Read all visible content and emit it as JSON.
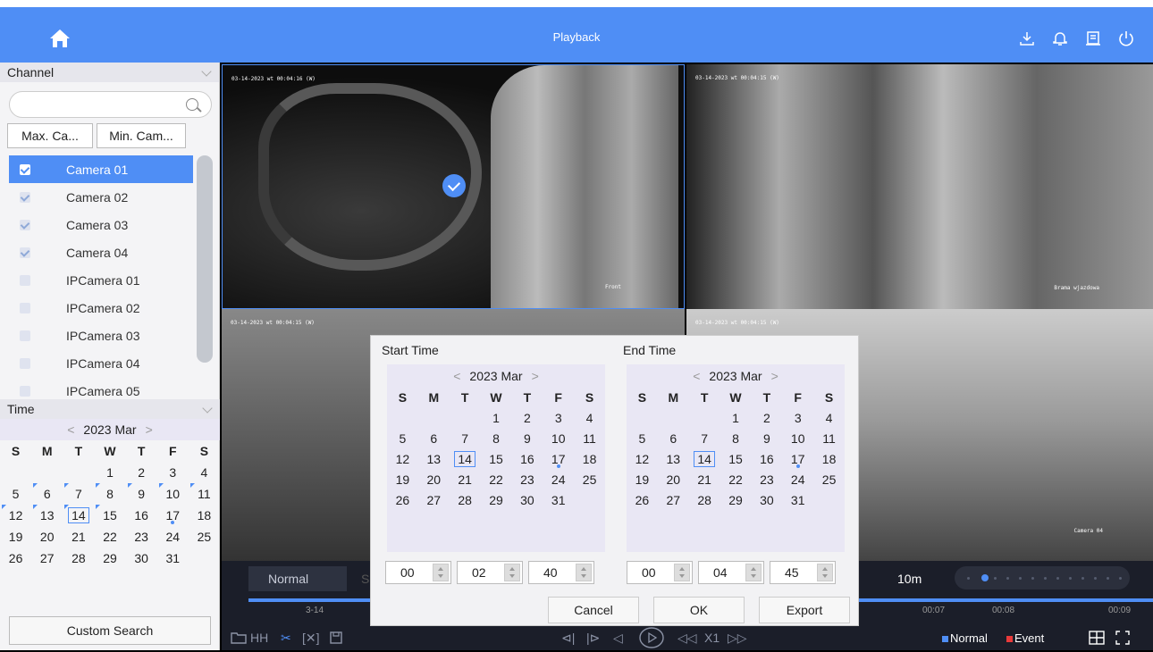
{
  "header": {
    "title": "Playback",
    "icons": [
      "home-icon",
      "download-icon",
      "bell-icon",
      "export-icon",
      "power-icon"
    ]
  },
  "sidebar": {
    "channel_label": "Channel",
    "search_placeholder": "",
    "max_button": "Max. Ca...",
    "min_button": "Min. Cam...",
    "cameras": [
      {
        "label": "Camera 01",
        "checked": true,
        "selected": true
      },
      {
        "label": "Camera 02",
        "checked": true,
        "selected": false
      },
      {
        "label": "Camera 03",
        "checked": true,
        "selected": false
      },
      {
        "label": "Camera 04",
        "checked": true,
        "selected": false
      },
      {
        "label": "IPCamera 01",
        "checked": false,
        "selected": false
      },
      {
        "label": "IPCamera 02",
        "checked": false,
        "selected": false
      },
      {
        "label": "IPCamera 03",
        "checked": false,
        "selected": false
      },
      {
        "label": "IPCamera 04",
        "checked": false,
        "selected": false
      },
      {
        "label": "IPCamera 05",
        "checked": false,
        "selected": false
      }
    ],
    "time_label": "Time",
    "calendar": {
      "title": "2023 Mar",
      "weekdays": [
        "S",
        "M",
        "T",
        "W",
        "T",
        "F",
        "S"
      ]
    },
    "custom_search": "Custom Search"
  },
  "videos": [
    {
      "osd": "03-14-2023 wt 00:04:16 (W)",
      "name": "Front"
    },
    {
      "osd": "03-14-2023 wt 00:04:15 (W)",
      "name": "Brama wjazdowa"
    },
    {
      "osd": "03-14-2023 wt 00:04:15 (W)",
      "name": ""
    },
    {
      "osd": "03-14-2023 wt 00:04:15 (W)",
      "name": "Camera 04"
    }
  ],
  "timeline": {
    "mode": "Normal",
    "mode2": "S",
    "zoom": "10m",
    "ticks": [
      "3-14",
      "00:07",
      "00:08",
      "00:09"
    ],
    "legend_normal": "Normal",
    "legend_event": "Event",
    "speed": "X1",
    "colors": {
      "normal": "#4f8ef5",
      "event": "#e83a3a"
    }
  },
  "dialog": {
    "start_label": "Start Time",
    "end_label": "End Time",
    "month_title": "2023 Mar",
    "start_time": {
      "h": "00",
      "m": "02",
      "s": "40"
    },
    "end_time": {
      "h": "00",
      "m": "04",
      "s": "45"
    },
    "cancel": "Cancel",
    "ok": "OK",
    "export": "Export"
  },
  "colors": {
    "accent": "#4f8ef5",
    "header": "#4f8ef5",
    "sidebar": "#f4f4f6"
  }
}
